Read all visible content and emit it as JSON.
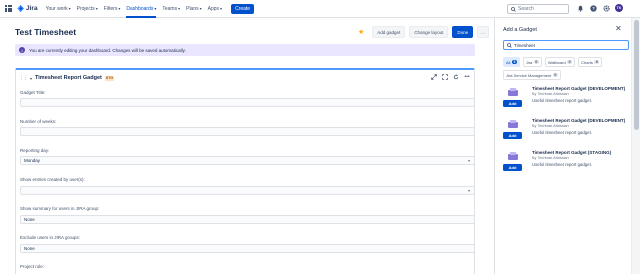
{
  "app": {
    "name": "Jira"
  },
  "nav": {
    "items": [
      {
        "label": "Your work",
        "active": false
      },
      {
        "label": "Projects",
        "active": false
      },
      {
        "label": "Filters",
        "active": false
      },
      {
        "label": "Dashboards",
        "active": true
      },
      {
        "label": "Teams",
        "active": false
      },
      {
        "label": "Plans",
        "active": false
      },
      {
        "label": "Apps",
        "active": false
      }
    ],
    "create_label": "Create",
    "search_placeholder": "Search",
    "avatar_initials": "TK"
  },
  "header": {
    "title": "Test Timesheet",
    "add_gadget_label": "Add gadget",
    "change_layout_label": "Change layout",
    "done_label": "Done",
    "more_label": "..."
  },
  "banner": {
    "text": "You are currently editing your dashboard. Changes will be saved automatically."
  },
  "gadget": {
    "title": "Timesheet Report Gadget",
    "badge": "STG",
    "fields": [
      {
        "label": "Gadget Title:",
        "value": ""
      },
      {
        "label": "Number of weeks:",
        "value": ""
      },
      {
        "label": "Reporting day:",
        "value": "Monday"
      },
      {
        "label": "Show entries created by user(s):",
        "value": ""
      },
      {
        "label": "Show summary for users in JIRA group:",
        "value": "None"
      },
      {
        "label": "Exclude users in JIRA groups:",
        "value": "None"
      },
      {
        "label": "Project role:",
        "value": ""
      }
    ]
  },
  "panel": {
    "title": "Add a Gadget",
    "search_value": "Timesheet",
    "filters": [
      {
        "label": "All",
        "count": "3",
        "selected": true
      },
      {
        "label": "Jira",
        "count": "0",
        "selected": false
      },
      {
        "label": "Wallboard",
        "count": "0",
        "selected": false
      },
      {
        "label": "Charts",
        "count": "0",
        "selected": false
      },
      {
        "label": "Jira Service Management",
        "count": "0",
        "selected": false
      }
    ],
    "add_label": "Add",
    "gadgets": [
      {
        "name": "Timesheet Report Gadget (DEVELOPMENT)",
        "by": "By Techtask Atlassian",
        "description": "Useful timesheet report gadget."
      },
      {
        "name": "Timesheet Report Gadget (DEVELOPMENT)",
        "by": "By Techtask Atlassian",
        "description": "Useful timesheet report gadget."
      },
      {
        "name": "Timesheet Report Gadget (STAGING)",
        "by": "By Techtask Atlassian",
        "description": "Useful timesheet report gadget."
      }
    ]
  },
  "colors": {
    "brand": "#0052cc",
    "banner_bg": "#eae6ff",
    "star": "#ffab00"
  }
}
